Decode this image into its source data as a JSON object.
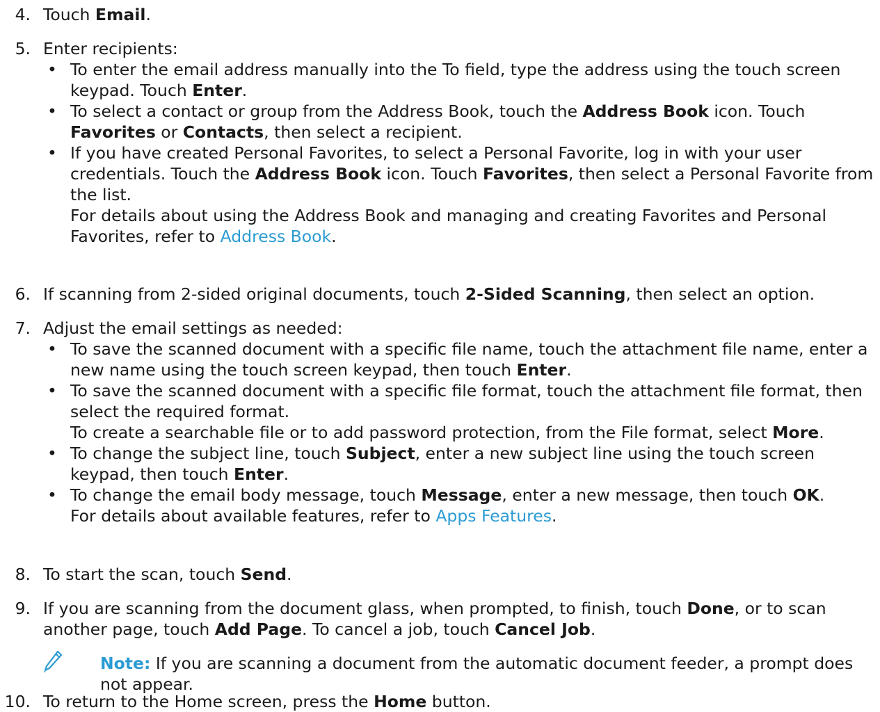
{
  "colors": {
    "link": "#2b9bd3",
    "note_label": "#2b9bd3",
    "text": "#1a1a1a"
  },
  "steps": {
    "s4": {
      "num": "4.",
      "t1": "Touch ",
      "b1": "Email",
      "t2": "."
    },
    "s5": {
      "num": "5.",
      "intro": "Enter recipients:",
      "b_1": {
        "t1": "To enter the email address manually into the To field, type the address using the touch screen keypad. Touch ",
        "b1": "Enter",
        "t2": "."
      },
      "b_2": {
        "t1": "To select a contact or group from the Address Book, touch the ",
        "b1": "Address Book",
        "t2": " icon. Touch ",
        "b2": "Favorites",
        "t3": " or ",
        "b3": "Contacts",
        "t4": ", then select a recipient."
      },
      "b_3": {
        "t1": "If you have created Personal Favorites, to select a Personal Favorite, log in with your user credentials. Touch the ",
        "b1": "Address Book",
        "t2": " icon. Touch ",
        "b2": "Favorites",
        "t3": ", then select a Personal Favorite from the list.",
        "p1": "For details about using the Address Book and managing and creating Favorites and Personal Favorites, refer to ",
        "link": "Address Book",
        "p2": "."
      }
    },
    "s6": {
      "num": "6.",
      "t1": "If scanning from 2-sided original documents, touch ",
      "b1": "2-Sided Scanning",
      "t2": ", then select an option."
    },
    "s7": {
      "num": "7.",
      "intro": "Adjust the email settings as needed:",
      "b_1": {
        "t1": "To save the scanned document with a specific file name, touch the attachment file name, enter a new name using the touch screen keypad, then touch ",
        "b1": "Enter",
        "t2": "."
      },
      "b_2": {
        "t1": "To save the scanned document with a specific file format, touch the attachment file format, then select the required format.",
        "p1": "To create a searchable file or to add password protection, from the File format, select ",
        "pb": "More",
        "p2": "."
      },
      "b_3": {
        "t1": "To change the subject line, touch ",
        "b1": "Subject",
        "t2": ", enter a new subject line using the touch screen keypad, then touch ",
        "b2": "Enter",
        "t3": "."
      },
      "b_4": {
        "t1": "To change the email body message, touch ",
        "b1": "Message",
        "t2": ", enter a new message, then touch ",
        "b2": "OK",
        "t3": ".",
        "p1": "For details about available features, refer to ",
        "link": "Apps Features",
        "p2": "."
      }
    },
    "s8": {
      "num": "8.",
      "t1": "To start the scan, touch ",
      "b1": "Send",
      "t2": "."
    },
    "s9": {
      "num": "9.",
      "t1": "If you are scanning from the document glass, when prompted, to finish, touch ",
      "b1": "Done",
      "t2": ", or to scan another page, touch ",
      "b2": "Add Page",
      "t3": ". To cancel a job, touch ",
      "b3": "Cancel Job",
      "t4": ".",
      "note": {
        "icon": "pencil-icon",
        "label": "Note:",
        "text": " If you are scanning a document from the automatic document feeder, a prompt does not appear."
      }
    },
    "s10": {
      "num": "10.",
      "t1": "To return to the Home screen, press the ",
      "b1": "Home",
      "t2": " button."
    }
  }
}
